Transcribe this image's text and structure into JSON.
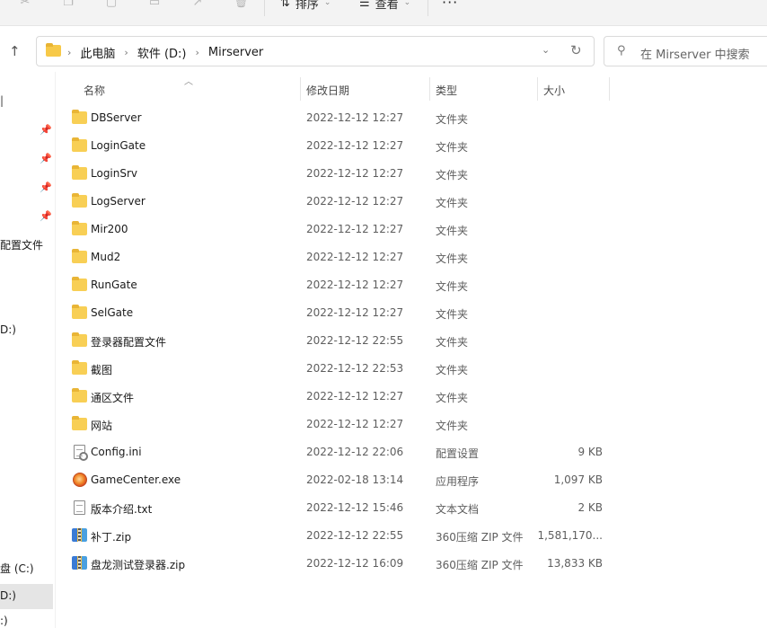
{
  "toolbar": {
    "sort_label": "排序",
    "view_label": "查看",
    "more_label": "···"
  },
  "address": {
    "breadcrumbs": [
      "此电脑",
      "软件 (D:)",
      "Mirserver"
    ]
  },
  "search": {
    "placeholder": "在 Mirserver 中搜索"
  },
  "nav": {
    "cut_labels": [
      "|",
      "配置文件",
      "D:)",
      "盘 (C:)",
      "D:)",
      ":)"
    ]
  },
  "columns": {
    "name": "名称",
    "date": "修改日期",
    "type": "类型",
    "size": "大小"
  },
  "files": [
    {
      "name": "DBServer",
      "date": "2022-12-12 12:27",
      "type": "文件夹",
      "size": "",
      "icon": "folder-icon"
    },
    {
      "name": "LoginGate",
      "date": "2022-12-12 12:27",
      "type": "文件夹",
      "size": "",
      "icon": "folder-icon"
    },
    {
      "name": "LoginSrv",
      "date": "2022-12-12 12:27",
      "type": "文件夹",
      "size": "",
      "icon": "folder-icon"
    },
    {
      "name": "LogServer",
      "date": "2022-12-12 12:27",
      "type": "文件夹",
      "size": "",
      "icon": "folder-icon"
    },
    {
      "name": "Mir200",
      "date": "2022-12-12 12:27",
      "type": "文件夹",
      "size": "",
      "icon": "folder-icon"
    },
    {
      "name": "Mud2",
      "date": "2022-12-12 12:27",
      "type": "文件夹",
      "size": "",
      "icon": "folder-icon"
    },
    {
      "name": "RunGate",
      "date": "2022-12-12 12:27",
      "type": "文件夹",
      "size": "",
      "icon": "folder-icon"
    },
    {
      "name": "SelGate",
      "date": "2022-12-12 12:27",
      "type": "文件夹",
      "size": "",
      "icon": "folder-icon"
    },
    {
      "name": "登录器配置文件",
      "date": "2022-12-12 22:55",
      "type": "文件夹",
      "size": "",
      "icon": "folder-icon"
    },
    {
      "name": "截图",
      "date": "2022-12-12 22:53",
      "type": "文件夹",
      "size": "",
      "icon": "folder-icon"
    },
    {
      "name": "通区文件",
      "date": "2022-12-12 12:27",
      "type": "文件夹",
      "size": "",
      "icon": "folder-icon"
    },
    {
      "name": "网站",
      "date": "2022-12-12 12:27",
      "type": "文件夹",
      "size": "",
      "icon": "folder-icon"
    },
    {
      "name": "Config.ini",
      "date": "2022-12-12 22:06",
      "type": "配置设置",
      "size": "9 KB",
      "icon": "settings-file-icon"
    },
    {
      "name": "GameCenter.exe",
      "date": "2022-02-18 13:14",
      "type": "应用程序",
      "size": "1,097 KB",
      "icon": "exe-app-icon"
    },
    {
      "name": "版本介绍.txt",
      "date": "2022-12-12 15:46",
      "type": "文本文档",
      "size": "2 KB",
      "icon": "text-file-icon"
    },
    {
      "name": "补丁.zip",
      "date": "2022-12-12 22:55",
      "type": "360压缩 ZIP 文件",
      "size": "1,581,170...",
      "icon": "zip-archive-icon"
    },
    {
      "name": "盘龙测试登录器.zip",
      "date": "2022-12-12 16:09",
      "type": "360压缩 ZIP 文件",
      "size": "13,833 KB",
      "icon": "zip-archive-icon"
    }
  ]
}
